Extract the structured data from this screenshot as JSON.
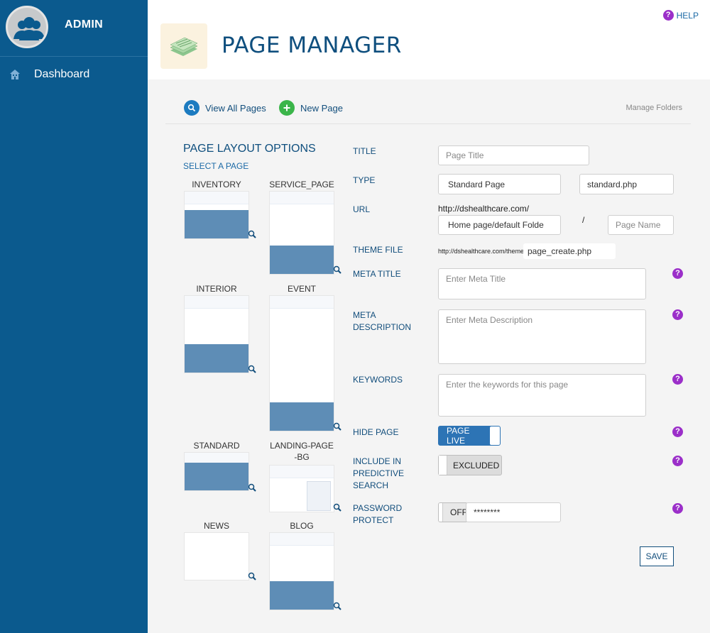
{
  "sidebar": {
    "admin_label": "ADMIN",
    "items": [
      {
        "label": "Dashboard",
        "icon": "home-icon"
      }
    ]
  },
  "header": {
    "title": "PAGE MANAGER",
    "help_label": "HELP"
  },
  "toolbar": {
    "view_all": "View All Pages",
    "new_page": "New Page",
    "manage_folders": "Manage Folders"
  },
  "layout_options": {
    "title": "PAGE LAYOUT OPTIONS",
    "subtitle": "SELECT A PAGE",
    "templates": [
      "INVENTORY",
      "SERVICE_PAGE",
      "INTERIOR",
      "EVENT",
      "STANDARD",
      "LANDING-PAGE-BG",
      "NEWS",
      "BLOG"
    ]
  },
  "form": {
    "title": {
      "label": "TITLE",
      "placeholder": "Page Title"
    },
    "type": {
      "label": "TYPE",
      "value": "Standard Page",
      "file": "standard.php"
    },
    "url": {
      "label": "URL",
      "prefix": "http://dshealthcare.com/",
      "folder": "Home page/default Folde",
      "separator": "/",
      "page_name_placeholder": "Page Name"
    },
    "theme_file": {
      "label": "THEME FILE",
      "prefix": "http://dshealthcare.com/theme/",
      "value": "page_create.php"
    },
    "meta_title": {
      "label": "META TITLE",
      "placeholder": "Enter Meta Title"
    },
    "meta_description": {
      "label_line1": "META",
      "label_line2": "DESCRIPTION",
      "placeholder": "Enter Meta Description"
    },
    "keywords": {
      "label": "KEYWORDS",
      "placeholder": "Enter the keywords for this page"
    },
    "hide_page": {
      "label": "HIDE PAGE",
      "state": "PAGE LIVE"
    },
    "predictive": {
      "label_line1": "INCLUDE IN",
      "label_line2": "PREDICTIVE",
      "label_line3": "SEARCH",
      "state": "EXCLUDED"
    },
    "password": {
      "label_line1": "PASSWORD",
      "label_line2": "PROTECT",
      "state": "OFF",
      "value": "********"
    },
    "save_label": "SAVE",
    "help_glyph": "?"
  },
  "colors": {
    "sidebar": "#0b5a8e",
    "title": "#0f4f7e",
    "toggle_on": "#2d74b5",
    "help_icon": "#9b2fc9",
    "new_page": "#3bb54a"
  }
}
